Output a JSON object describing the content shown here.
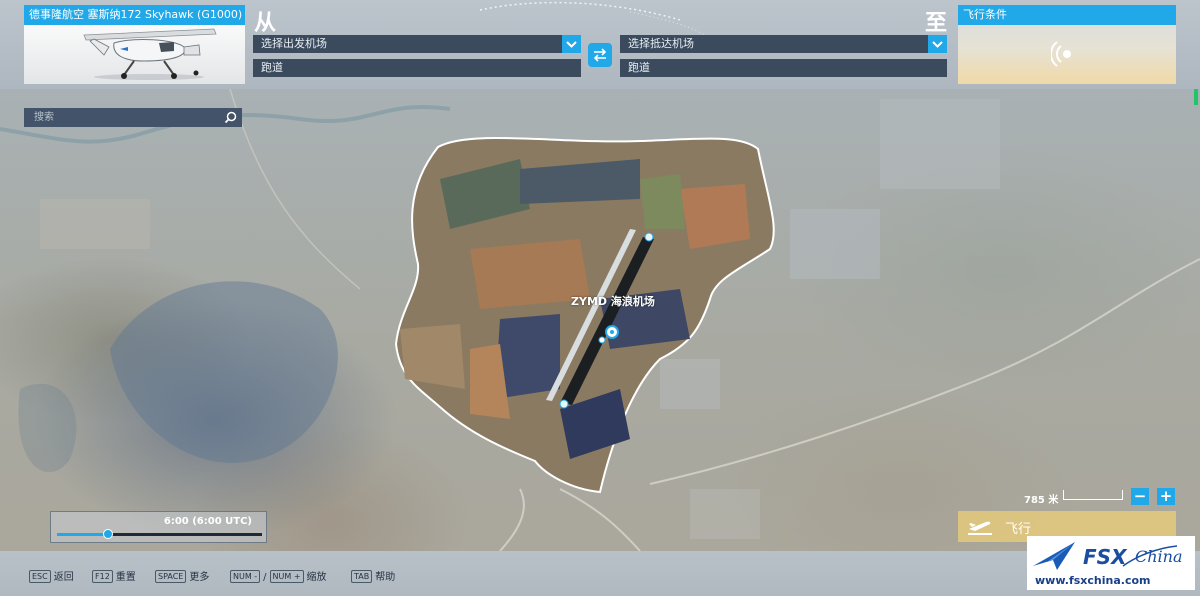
{
  "aircraft": {
    "title": "德事隆航空 塞斯纳172 Skyhawk (G1000)"
  },
  "route": {
    "from_label": "从",
    "to_label": "至",
    "departure_placeholder": "选择出发机场",
    "departure_runway": "跑道",
    "arrival_placeholder": "选择抵达机场",
    "arrival_runway": "跑道"
  },
  "conditions": {
    "title": "飞行条件"
  },
  "search": {
    "placeholder": "搜索"
  },
  "map": {
    "airport_label": "ZYMD 海浪机场",
    "time_text": "6:00 (6:00 UTC)",
    "time_fraction": 0.25,
    "scale_text": "785 米",
    "zoom_out": "−",
    "zoom_in": "+",
    "fly_label": "飞行"
  },
  "hints": [
    {
      "key": "ESC",
      "label": "返回"
    },
    {
      "key": "F12",
      "label": "重置"
    },
    {
      "key": "SPACE",
      "label": "更多"
    },
    {
      "key": "NUM -",
      "sep": "/",
      "key2": "NUM +",
      "label": "缩放"
    },
    {
      "key": "TAB",
      "label": "帮助"
    }
  ],
  "watermark": {
    "logo_text": "FSXChina",
    "url": "www.fsxchina.com"
  },
  "colors": {
    "accent": "#21a8e8",
    "panel": "#3b4a5d"
  }
}
